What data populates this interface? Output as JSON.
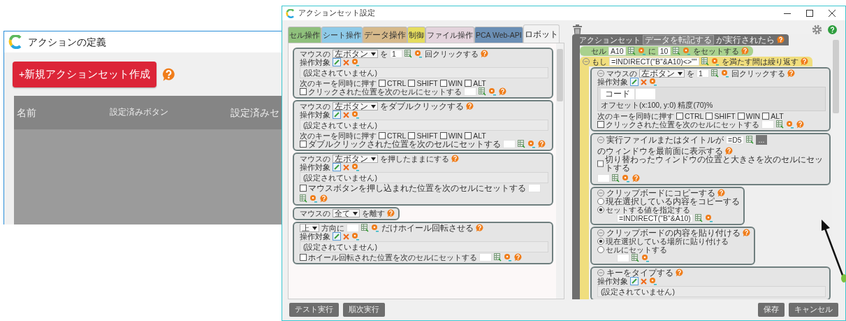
{
  "left_window": {
    "title": "アクションの定義",
    "new_button": "+新規アクションセット作成",
    "table": {
      "columns": [
        "名前",
        "設定済みボタン",
        "設定済みセ"
      ]
    }
  },
  "dialog": {
    "title": "アクションセット設定",
    "tabs": [
      {
        "label": "セル操作",
        "selected": false,
        "color": "#8fc07c"
      },
      {
        "label": "シート操作",
        "selected": false,
        "color": "#8ecae8"
      },
      {
        "label": "データ操作",
        "selected": false,
        "color": "#d6b98a"
      },
      {
        "label": "制御",
        "selected": false,
        "color": "#e5dd5e"
      },
      {
        "label": "ファイル操作",
        "selected": false,
        "color": "#e3d3dc"
      },
      {
        "label": "PCA Web-API",
        "selected": false,
        "color": "#6b8fb5"
      },
      {
        "label": "ロボット",
        "selected": true,
        "color": "#f2f2f2"
      }
    ],
    "palette": [
      {
        "kind": "action",
        "rows": [
          {
            "items": [
              {
                "kind": "text",
                "text": "マウスの"
              },
              {
                "kind": "select",
                "value": "左ボタン"
              },
              {
                "kind": "text",
                "text": "を"
              },
              {
                "kind": "cellref",
                "value": "1"
              },
              {
                "kind": "text",
                "text": "回クリックする"
              },
              {
                "kind": "help"
              }
            ]
          },
          {
            "items": [
              {
                "kind": "text",
                "text": "操作対象"
              },
              {
                "kind": "target"
              }
            ]
          },
          {
            "items": [
              {
                "kind": "note",
                "text": "(設定されていません)"
              }
            ]
          },
          {
            "items": [
              {
                "kind": "text",
                "text": "次のキーを同時に押す"
              },
              {
                "kind": "check",
                "label": "CTRL",
                "checked": false
              },
              {
                "kind": "check",
                "label": "SHIFT",
                "checked": false
              },
              {
                "kind": "check",
                "label": "WIN",
                "checked": false
              },
              {
                "kind": "check",
                "label": "ALT",
                "checked": false
              }
            ]
          },
          {
            "items": [
              {
                "kind": "check",
                "label": "クリックされた位置を次のセルにセットする",
                "checked": false
              },
              {
                "kind": "cellref"
              },
              {
                "kind": "help"
              }
            ]
          }
        ]
      },
      {
        "kind": "action",
        "rows": [
          {
            "items": [
              {
                "kind": "text",
                "text": "マウスの"
              },
              {
                "kind": "select",
                "value": "左ボタン"
              },
              {
                "kind": "text",
                "text": "をダブルクリックする"
              },
              {
                "kind": "help"
              }
            ]
          },
          {
            "items": [
              {
                "kind": "text",
                "text": "操作対象"
              },
              {
                "kind": "target"
              }
            ]
          },
          {
            "items": [
              {
                "kind": "note",
                "text": "(設定されていません)"
              }
            ]
          },
          {
            "items": [
              {
                "kind": "text",
                "text": "次のキーを同時に押す"
              },
              {
                "kind": "check",
                "label": "CTRL",
                "checked": false
              },
              {
                "kind": "check",
                "label": "SHIFT",
                "checked": false
              },
              {
                "kind": "check",
                "label": "WIN",
                "checked": false
              },
              {
                "kind": "check",
                "label": "ALT",
                "checked": false
              }
            ]
          },
          {
            "items": [
              {
                "kind": "check",
                "label": "ダブルクリックされた位置を次のセルにセットする",
                "checked": false
              },
              {
                "kind": "cellref"
              },
              {
                "kind": "help"
              }
            ]
          }
        ]
      },
      {
        "kind": "action",
        "rows": [
          {
            "items": [
              {
                "kind": "text",
                "text": "マウスの"
              },
              {
                "kind": "select",
                "value": "左ボタン"
              },
              {
                "kind": "text",
                "text": "を押したままにする"
              },
              {
                "kind": "help"
              }
            ]
          },
          {
            "items": [
              {
                "kind": "text",
                "text": "操作対象"
              },
              {
                "kind": "target"
              }
            ]
          },
          {
            "items": [
              {
                "kind": "note",
                "text": "(設定されていません)"
              }
            ]
          },
          {
            "items": [
              {
                "kind": "check",
                "label": "マウスボタンを押し込まれた位置を次のセルにセットする",
                "checked": false
              },
              {
                "kind": "cellref"
              },
              {
                "kind": "help"
              }
            ]
          }
        ]
      },
      {
        "kind": "action",
        "rows": [
          {
            "items": [
              {
                "kind": "text",
                "text": "マウスの"
              },
              {
                "kind": "select",
                "value": "全て"
              },
              {
                "kind": "text",
                "text": "を離す"
              },
              {
                "kind": "help"
              }
            ]
          }
        ]
      },
      {
        "kind": "action",
        "rows": [
          {
            "items": [
              {
                "kind": "select",
                "value": "上"
              },
              {
                "kind": "text",
                "text": "方向に"
              },
              {
                "kind": "cellref"
              },
              {
                "kind": "text",
                "text": "だけホイール回転させる"
              },
              {
                "kind": "help"
              }
            ]
          },
          {
            "items": [
              {
                "kind": "text",
                "text": "操作対象"
              },
              {
                "kind": "target"
              }
            ]
          },
          {
            "items": [
              {
                "kind": "note",
                "text": "(設定されていません)"
              }
            ]
          },
          {
            "items": [
              {
                "kind": "check",
                "label": "ホイール回転された位置を次のセルにセットする",
                "checked": false
              },
              {
                "kind": "cellref"
              },
              {
                "kind": "help"
              }
            ]
          }
        ]
      }
    ],
    "canvas": {
      "kind": "event",
      "rows": [
        {
          "items": [
            {
              "kind": "text",
              "text": "アクションセット"
            },
            {
              "kind": "chip",
              "text": "データを転記する"
            },
            {
              "kind": "text",
              "text": "が実行されたら"
            },
            {
              "kind": "help"
            }
          ]
        }
      ],
      "children": [
        {
          "kind": "cell",
          "rows": [
            {
              "items": [
                {
                  "kind": "text",
                  "text": "セル"
                },
                {
                  "kind": "cellref",
                  "value": "A10"
                },
                {
                  "kind": "text",
                  "text": "に"
                },
                {
                  "kind": "cellref",
                  "value": "10"
                },
                {
                  "kind": "text",
                  "text": "をセットする"
                },
                {
                  "kind": "help"
                }
              ]
            }
          ]
        },
        {
          "kind": "loop",
          "expanded": true,
          "rows": [
            {
              "items": [
                {
                  "kind": "text",
                  "text": "もし"
                },
                {
                  "kind": "cellref",
                  "value": "=INDIRECT(\"B\"&A10)<>\"\""
                },
                {
                  "kind": "text",
                  "text": "を満たす間は繰り返す"
                },
                {
                  "kind": "help"
                }
              ]
            }
          ],
          "children": [
            {
              "kind": "action",
              "expanded": true,
              "rows": [
                {
                  "items": [
                    {
                      "kind": "text",
                      "text": "マウスの"
                    },
                    {
                      "kind": "select",
                      "value": "左ボタン"
                    },
                    {
                      "kind": "text",
                      "text": "を"
                    },
                    {
                      "kind": "cellref",
                      "value": "1"
                    },
                    {
                      "kind": "text",
                      "text": "回クリックする"
                    },
                    {
                      "kind": "help"
                    }
                  ]
                },
                {
                  "items": [
                    {
                      "kind": "text",
                      "text": "操作対象"
                    },
                    {
                      "kind": "target"
                    }
                  ]
                },
                {
                  "items": [
                    {
                      "kind": "image",
                      "label": "コード",
                      "caption": "オフセット(x:100, y:0) 精度(70)%"
                    }
                  ]
                },
                {
                  "items": [
                    {
                      "kind": "text",
                      "text": "次のキーを同時に押す"
                    },
                    {
                      "kind": "check",
                      "label": "CTRL",
                      "checked": false
                    },
                    {
                      "kind": "check",
                      "label": "SHIFT",
                      "checked": false
                    },
                    {
                      "kind": "check",
                      "label": "WIN",
                      "checked": false
                    },
                    {
                      "kind": "check",
                      "label": "ALT",
                      "checked": false
                    }
                  ]
                },
                {
                  "items": [
                    {
                      "kind": "check",
                      "label": "クリックされた位置を次のセルにセットする",
                      "checked": false
                    },
                    {
                      "kind": "cellref"
                    },
                    {
                      "kind": "help"
                    }
                  ]
                }
              ]
            },
            {
              "kind": "action",
              "expanded": true,
              "rows": [
                {
                  "items": [
                    {
                      "kind": "text",
                      "text": "実行ファイルまたはタイトルが"
                    },
                    {
                      "kind": "cellpick",
                      "value": "=D5"
                    },
                    {
                      "kind": "button",
                      "text": "..."
                    },
                    {
                      "kind": "text",
                      "text": "のウィンドウを最前面に表示する"
                    },
                    {
                      "kind": "help"
                    }
                  ]
                },
                {
                  "items": [
                    {
                      "kind": "check",
                      "label": "切り替わったウィンドウの位置と大きさを次のセルにセットする",
                      "checked": false
                    },
                    {
                      "kind": "cellref"
                    },
                    {
                      "kind": "help"
                    }
                  ]
                }
              ]
            },
            {
              "kind": "action",
              "expanded": true,
              "rows": [
                {
                  "items": [
                    {
                      "kind": "text",
                      "text": "クリップボードにコピーする"
                    },
                    {
                      "kind": "help"
                    }
                  ]
                },
                {
                  "items": [
                    {
                      "kind": "radio",
                      "label": "現在選択している内容をコピーする",
                      "selected": false
                    }
                  ]
                },
                {
                  "items": [
                    {
                      "kind": "radio",
                      "label": "セットする値を指定する",
                      "selected": true
                    }
                  ]
                },
                {
                  "items": [
                    {
                      "kind": "cellref",
                      "value": "=INDIRECT(\"B\"&A10)"
                    }
                  ]
                }
              ]
            },
            {
              "kind": "action",
              "expanded": true,
              "rows": [
                {
                  "items": [
                    {
                      "kind": "text",
                      "text": "クリップボードの内容を貼り付ける"
                    },
                    {
                      "kind": "help"
                    }
                  ]
                },
                {
                  "items": [
                    {
                      "kind": "radio",
                      "label": "現在選択している場所に貼り付ける",
                      "selected": true
                    }
                  ]
                },
                {
                  "items": [
                    {
                      "kind": "radio",
                      "label": "セルにセットする",
                      "selected": false
                    }
                  ]
                },
                {
                  "items": [
                    {
                      "kind": "cellref"
                    }
                  ]
                }
              ]
            },
            {
              "kind": "action",
              "expanded": true,
              "rows": [
                {
                  "items": [
                    {
                      "kind": "text",
                      "text": "キーをタイプする"
                    },
                    {
                      "kind": "help"
                    }
                  ]
                },
                {
                  "items": [
                    {
                      "kind": "text",
                      "text": "操作対象"
                    },
                    {
                      "kind": "target"
                    }
                  ]
                },
                {
                  "items": [
                    {
                      "kind": "note",
                      "text": "(設定されていません)"
                    }
                  ]
                }
              ]
            }
          ]
        }
      ]
    },
    "footer_left": [
      "テスト実行",
      "順次実行"
    ],
    "footer_right": [
      "保存",
      "キャンセル"
    ]
  }
}
